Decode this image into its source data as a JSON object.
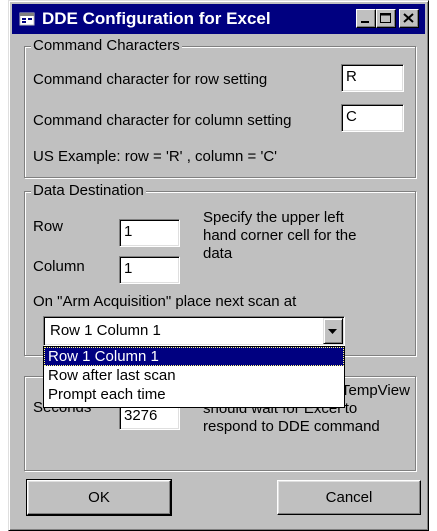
{
  "window": {
    "title": "DDE Configuration for Excel"
  },
  "command_characters": {
    "group_label": "Command Characters",
    "row_label": "Command character for row setting",
    "row_value": "R",
    "column_label": "Command character for column setting",
    "column_value": "C",
    "example_text": "US Example:  row = 'R' , column = 'C'"
  },
  "data_destination": {
    "group_label": "Data Destination",
    "row_label": "Row",
    "row_value": "1",
    "column_label": "Column",
    "column_value": "1",
    "help_text_1": "Specify the upper left",
    "help_text_2": "hand corner cell for the",
    "help_text_3": "data",
    "arm_label": "On \"Arm Acquisition\" place next scan at",
    "selected_option": "Row  1  Column  1",
    "options": [
      "Row  1  Column  1",
      "Row after last scan",
      "Prompt each time"
    ]
  },
  "timeout": {
    "seconds_label": "Seconds",
    "seconds_value": "3276",
    "help_text_1": "TempView",
    "help_text_2": "should wait for Excel to",
    "help_text_3": "respond to DDE command"
  },
  "buttons": {
    "ok_label": "OK",
    "cancel_label": "Cancel"
  },
  "icons": {
    "app": "excel-dde-icon",
    "minimize": "minimize-icon",
    "maximize": "maximize-icon",
    "close": "close-icon",
    "dropdown": "chevron-down-icon"
  }
}
